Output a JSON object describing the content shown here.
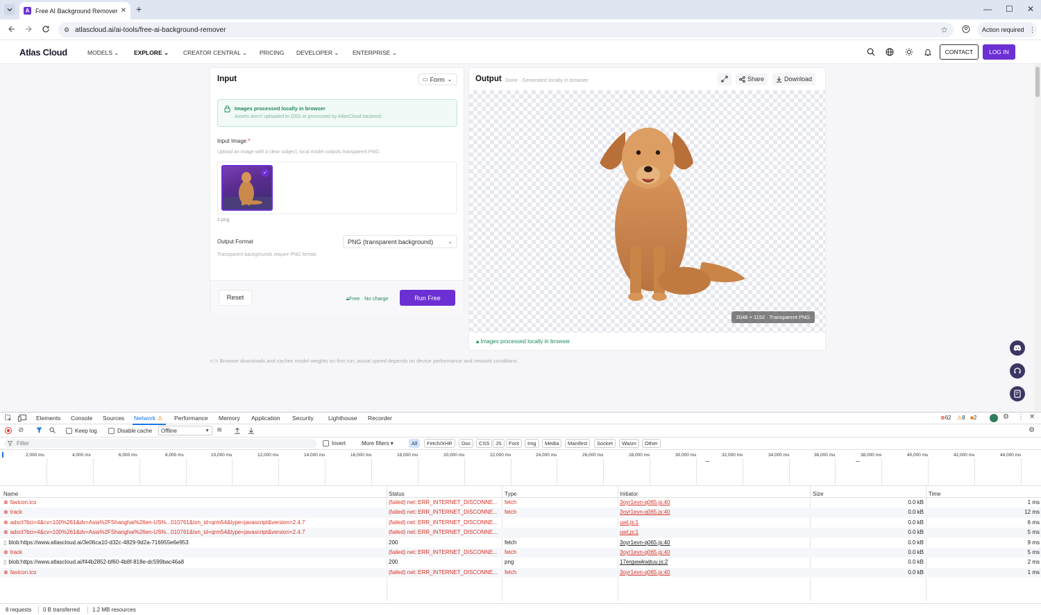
{
  "browser": {
    "tab_title": "Free AI Background Remover",
    "url": "atlascloud.ai/ai-tools/free-ai-background-remover",
    "action_label": "Action required"
  },
  "site": {
    "logo": "Atlas Cloud",
    "nav": [
      "MODELS",
      "EXPLORE",
      "CREATOR CENTRAL",
      "PRICING",
      "DEVELOPER",
      "ENTERPRISE"
    ],
    "contact": "CONTACT",
    "login": "LOG IN"
  },
  "input": {
    "title": "Input",
    "form_toggle": "Form",
    "notice_title": "Images processed locally in browser",
    "notice_sub": "Assets aren't uploaded to OSS or processed by AtlasCloud backend.",
    "image_label": "Input Image",
    "required": "*",
    "image_hint": "Upload an image with a clear subject; local model outputs transparent PNG.",
    "filename": "2.png",
    "format_label": "Output Format",
    "format_value": "PNG (transparent background)",
    "format_hint": "Transparent backgrounds require PNG format.",
    "reset": "Reset",
    "free": "Free · No charge",
    "run": "Run Free"
  },
  "output": {
    "title": "Output",
    "subtitle": "Done · Generated locally in browser",
    "share": "Share",
    "download": "Download",
    "dims": "2048 × 1152 · Transparent PNG",
    "footer": "Images processed locally in browser"
  },
  "note": "Browser downloads and caches model weights on first run; actual speed depends on device performance and network conditions.",
  "devtools": {
    "tabs": [
      "Elements",
      "Console",
      "Sources",
      "Network",
      "Performance",
      "Memory",
      "Application",
      "Security",
      "Lighthouse",
      "Recorder"
    ],
    "errors": "62",
    "warnings": "8",
    "issues": "2",
    "keep_log": "Keep log",
    "disable_cache": "Disable cache",
    "throttle": "Offline",
    "filter_placeholder": "Filter",
    "invert": "Invert",
    "more_filters": "More filters",
    "type_filters": [
      "All",
      "Fetch/XHR",
      "Doc",
      "CSS",
      "JS",
      "Font",
      "Img",
      "Media",
      "Manifest",
      "Socket",
      "Wasm",
      "Other"
    ],
    "ticks": [
      "2,000 ms",
      "4,000 ms",
      "6,000 ms",
      "8,000 ms",
      "10,000 ms",
      "12,000 ms",
      "14,000 ms",
      "16,000 ms",
      "18,000 ms",
      "20,000 ms",
      "22,000 ms",
      "24,000 ms",
      "26,000 ms",
      "28,000 ms",
      "30,000 ms",
      "32,000 ms",
      "34,000 ms",
      "36,000 ms",
      "38,000 ms",
      "40,000 ms",
      "42,000 ms",
      "44,000 ms"
    ],
    "columns": [
      "Name",
      "Status",
      "Type",
      "Initiator",
      "Size",
      "Time"
    ],
    "rows": [
      {
        "name": "favicon.ico",
        "status": "(failed) net::ERR_INTERNET_DISCONNE...",
        "type": "fetch",
        "initiator": "3oyr1evn-q065.js:40",
        "size": "0.0 kB",
        "time": "1 ms",
        "failed": true
      },
      {
        "name": "track",
        "status": "(failed) net::ERR_INTERNET_DISCONNE...",
        "type": "fetch",
        "initiator": "3oyr1evn-q065.js:40",
        "size": "0.0 kB",
        "time": "12 ms",
        "failed": true
      },
      {
        "name": "adsct?bci=4&cv=100%261&dv=Asia%2FShanghai%26en-US%...010761&txn_id=qrm54&type=javascript&version=2.4.7",
        "status": "(failed) net::ERR_INTERNET_DISCONNE...",
        "type": "",
        "initiator": "uwt.js:1",
        "size": "0.0 kB",
        "time": "6 ms",
        "failed": true
      },
      {
        "name": "adsct?bci=4&cv=100%261&dv=Asia%2FShanghai%26en-US%...010761&txn_id=qrm54&type=javascript&version=2.4.7",
        "status": "(failed) net::ERR_INTERNET_DISCONNE...",
        "type": "",
        "initiator": "uwt.js:1",
        "size": "0.0 kB",
        "time": "5 ms",
        "failed": true
      },
      {
        "name": "blob:https://www.atlascloud.ai/3e06ca10-d32c-4829-9d2a-716955e6e953",
        "status": "200",
        "type": "fetch",
        "initiator": "3oyr1evn-q065.js:40",
        "size": "0.0 kB",
        "time": "9 ms",
        "failed": false
      },
      {
        "name": "track",
        "status": "(failed) net::ERR_INTERNET_DISCONNE...",
        "type": "fetch",
        "initiator": "3oyr1evn-q065.js:40",
        "size": "0.0 kB",
        "time": "5 ms",
        "failed": true
      },
      {
        "name": "blob:https://www.atlascloud.ai/f44b2852-bf60-4b8f-818e-dc599bac46a8",
        "status": "200",
        "type": "png",
        "initiator": "17ergwwkwjtuu.js:2",
        "size": "0.0 kB",
        "time": "2 ms",
        "failed": false
      },
      {
        "name": "favicon.ico",
        "status": "(failed) net::ERR_INTERNET_DISCONNE...",
        "type": "fetch",
        "initiator": "3oyr1evn-q065.js:40",
        "size": "0.0 kB",
        "time": "1 ms",
        "failed": true
      }
    ],
    "summary": {
      "requests": "8 requests",
      "transferred": "0 B transferred",
      "resources": "1.2 MB resources"
    }
  }
}
